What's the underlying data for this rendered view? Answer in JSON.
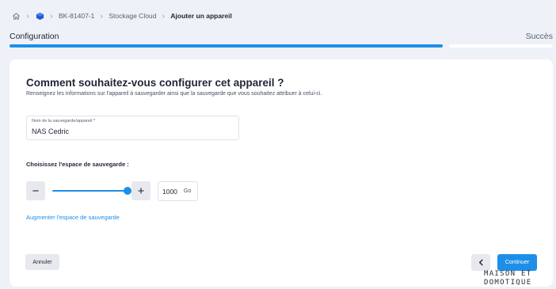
{
  "breadcrumb": {
    "items": [
      "BK-81407-1",
      "Stockage Cloud"
    ],
    "current": "Ajouter un appareil",
    "home_icon": "home-icon",
    "device_icon": "cube-icon",
    "separator_icon": "chevron-right-icon"
  },
  "steps": {
    "active": "Configuration",
    "inactive": "Succès",
    "progress_fraction": 0.81
  },
  "form": {
    "title": "Comment souhaitez-vous configurer cet appareil ?",
    "subtitle": "Renseignez les informations sur l'appareil à sauvegarder ainsi que la sauvegarde que vous souhaitez attribuer à celui-ci.",
    "name_field": {
      "label": "Nom de la sauvegarde/appareil *",
      "value": "NAS Cedric"
    },
    "space_label": "Choisissez l'espace de sauvegarde :",
    "minus_label": "−",
    "plus_label": "+",
    "slider_fraction": 1.0,
    "size_value": "1000",
    "size_unit": "Go",
    "increase_link": "Augmenter l'espace de sauvegarde"
  },
  "actions": {
    "cancel_label": "Annuler",
    "continue_label": "Continuer"
  },
  "watermark": {
    "line1": "MAISON ET",
    "line2": "DOMOTIQUE"
  },
  "colors": {
    "accent": "#1e8fe8",
    "background": "#eef1f7",
    "card": "#ffffff",
    "neutral_button": "#e7e9ee"
  }
}
